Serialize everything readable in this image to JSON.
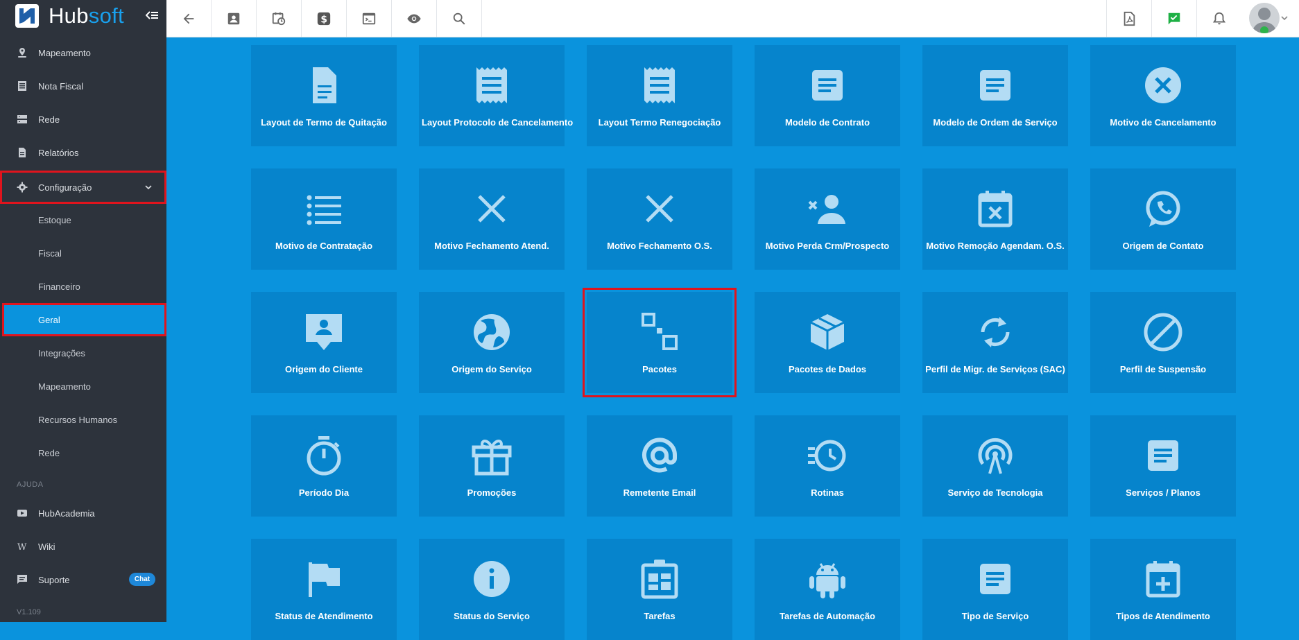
{
  "app": {
    "logo_hub": "Hub",
    "logo_soft": "soft",
    "version": "V1.109"
  },
  "sidebar": {
    "items": [
      {
        "label": "Mapeamento"
      },
      {
        "label": "Nota Fiscal"
      },
      {
        "label": "Rede"
      },
      {
        "label": "Relatórios"
      },
      {
        "label": "Configuração"
      }
    ],
    "subitems": [
      {
        "label": "Estoque"
      },
      {
        "label": "Fiscal"
      },
      {
        "label": "Financeiro"
      },
      {
        "label": "Geral"
      },
      {
        "label": "Integrações"
      },
      {
        "label": "Mapeamento"
      },
      {
        "label": "Recursos Humanos"
      },
      {
        "label": "Rede"
      }
    ],
    "help_title": "AJUDA",
    "help_items": [
      {
        "label": "HubAcademia"
      },
      {
        "label": "Wiki"
      },
      {
        "label": "Suporte",
        "badge": "Chat"
      }
    ]
  },
  "colors": {
    "accent": "#0a93dd",
    "tile": "#0684cc",
    "sidebar": "#2d333c",
    "highlight": "#e0141d",
    "icon": "#b3dcf4"
  },
  "tiles": [
    {
      "label": "Layout de Termo de Quitação",
      "icon": "document-icon"
    },
    {
      "label": "Layout Protocolo de Cancelamento",
      "icon": "receipt-icon"
    },
    {
      "label": "Layout Termo Renegociação",
      "icon": "receipt-icon"
    },
    {
      "label": "Modelo de Contrato",
      "icon": "article-icon"
    },
    {
      "label": "Modelo de Ordem de Serviço",
      "icon": "article-icon"
    },
    {
      "label": "Motivo de Cancelamento",
      "icon": "cancel-circle-icon"
    },
    {
      "label": "Motivo de Contratação",
      "icon": "list-icon"
    },
    {
      "label": "Motivo Fechamento Atend.",
      "icon": "close-icon"
    },
    {
      "label": "Motivo Fechamento O.S.",
      "icon": "close-icon"
    },
    {
      "label": "Motivo Perda Crm/Prospecto",
      "icon": "person-remove-icon"
    },
    {
      "label": "Motivo Remoção Agendam. O.S.",
      "icon": "calendar-x-icon"
    },
    {
      "label": "Origem de Contato",
      "icon": "whatsapp-icon"
    },
    {
      "label": "Origem do Cliente",
      "icon": "contact-chat-icon"
    },
    {
      "label": "Origem do Serviço",
      "icon": "globe-icon"
    },
    {
      "label": "Pacotes",
      "icon": "squares-icon"
    },
    {
      "label": "Pacotes de Dados",
      "icon": "box-icon"
    },
    {
      "label": "Perfil de Migr. de Serviços (SAC)",
      "icon": "sync-icon"
    },
    {
      "label": "Perfil de Suspensão",
      "icon": "block-icon"
    },
    {
      "label": "Período Dia",
      "icon": "timer-icon"
    },
    {
      "label": "Promoções",
      "icon": "gift-icon"
    },
    {
      "label": "Remetente Email",
      "icon": "at-icon"
    },
    {
      "label": "Rotinas",
      "icon": "history-icon"
    },
    {
      "label": "Serviço de Tecnologia",
      "icon": "antenna-icon"
    },
    {
      "label": "Serviços / Planos",
      "icon": "article-icon"
    },
    {
      "label": "Status de Atendimento",
      "icon": "flag-icon"
    },
    {
      "label": "Status do Serviço",
      "icon": "info-icon"
    },
    {
      "label": "Tarefas",
      "icon": "dashboard-icon"
    },
    {
      "label": "Tarefas de Automação",
      "icon": "android-icon"
    },
    {
      "label": "Tipo de Serviço",
      "icon": "article-icon"
    },
    {
      "label": "Tipos de Atendimento",
      "icon": "calendar-plus-icon"
    }
  ]
}
